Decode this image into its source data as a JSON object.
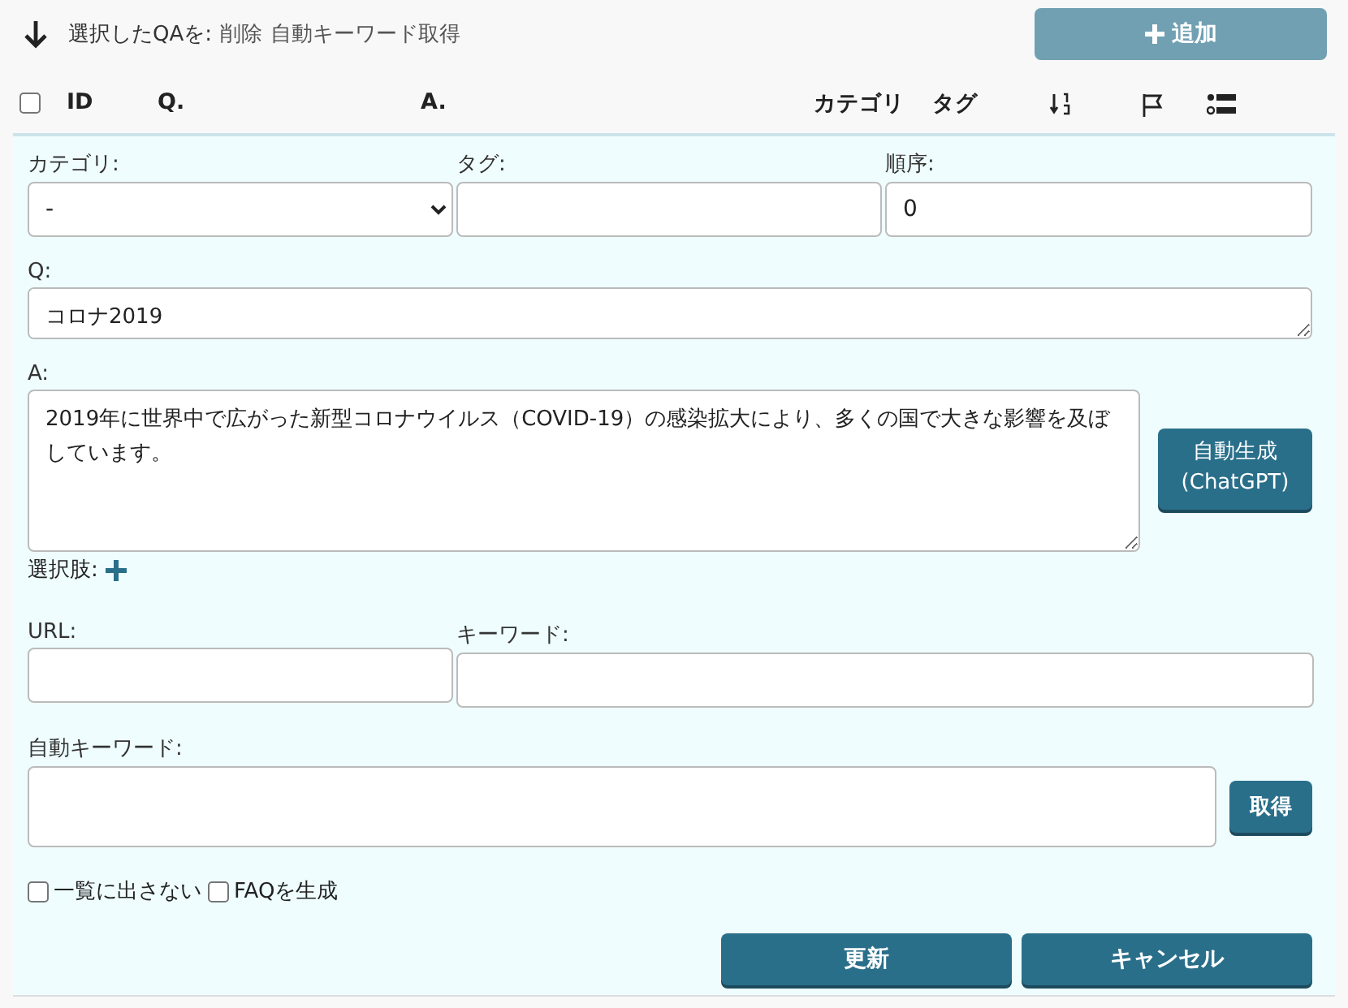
{
  "toolbar": {
    "selected_label": "選択したQAを:",
    "actions": [
      "削除",
      "自動キーワード取得"
    ],
    "add_button": "追加"
  },
  "header": {
    "select_all_checked": false,
    "columns": [
      "ID",
      "Q.",
      "A.",
      "カテゴリ",
      "タグ"
    ]
  },
  "form": {
    "category": {
      "label": "カテゴリ:",
      "value": "-"
    },
    "tag": {
      "label": "タグ:"
    },
    "order": {
      "label": "順序:",
      "value": "0"
    },
    "q": {
      "label": "Q:",
      "value": "コロナ2019"
    },
    "a": {
      "label": "A:",
      "value": "2019年に世界中で広がった新型コロナウイルス（COVID-19）の感染拡大により、多くの国で大きな影響を及ぼしています。"
    },
    "generate_button": [
      "自動生成",
      "(ChatGPT)"
    ],
    "choices_label": "選択肢:",
    "url": {
      "label": "URL:"
    },
    "keyword": {
      "label": "キーワード:"
    },
    "auto_keyword": {
      "label": "自動キーワード:"
    },
    "fetch_button": "取得",
    "checkboxes": [
      {
        "label": "一覧に出さない",
        "checked": false
      },
      {
        "label": "FAQを生成",
        "checked": false
      }
    ],
    "update_button": "更新",
    "cancel_button": "キャンセル"
  }
}
